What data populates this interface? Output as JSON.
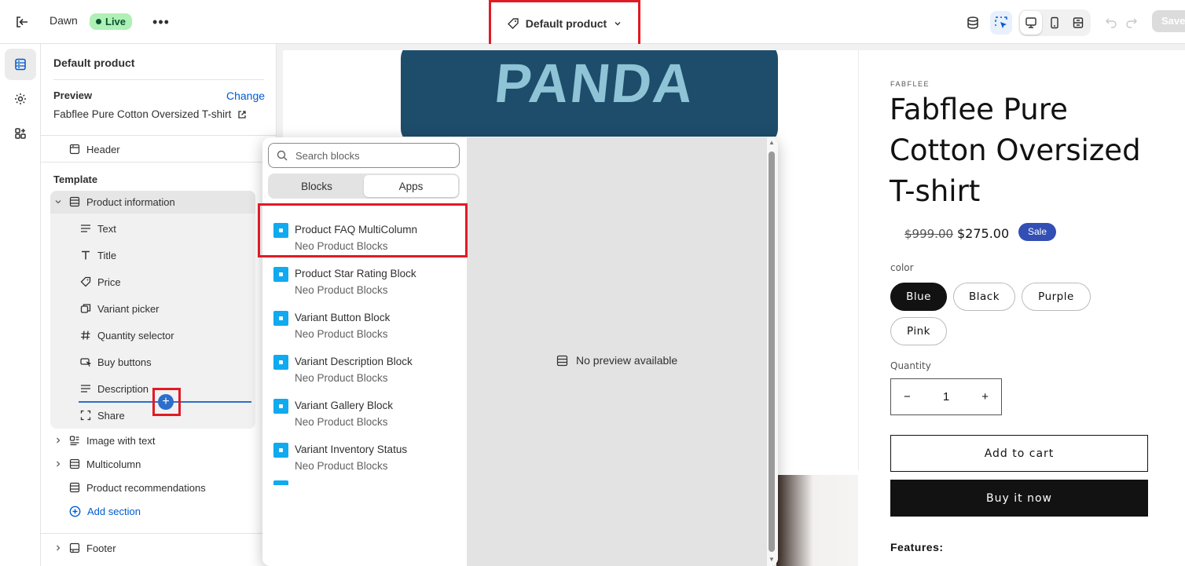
{
  "topbar": {
    "theme_name": "Dawn",
    "live_label": "Live",
    "template_label": "Default product",
    "save_label": "Save"
  },
  "sidebar": {
    "title": "Default product",
    "preview_label": "Preview",
    "change_label": "Change",
    "preview_product": "Fabflee Pure Cotton Oversized T-shirt",
    "header_label": "Header",
    "template_label": "Template",
    "product_information": "Product information",
    "blocks": [
      "Text",
      "Title",
      "Price",
      "Variant picker",
      "Quantity selector",
      "Buy buttons",
      "Description",
      "Share"
    ],
    "sections": [
      "Image with text",
      "Multicolumn",
      "Product recommendations"
    ],
    "add_section": "Add section",
    "footer_label": "Footer"
  },
  "popover": {
    "search_placeholder": "Search blocks",
    "tabs": [
      "Blocks",
      "Apps"
    ],
    "active_tab": "Apps",
    "items": [
      {
        "title": "Product FAQ MultiColumn",
        "subtitle": "Neo Product Blocks"
      },
      {
        "title": "Product Star Rating Block",
        "subtitle": "Neo Product Blocks"
      },
      {
        "title": "Variant Button Block",
        "subtitle": "Neo Product Blocks"
      },
      {
        "title": "Variant Description Block",
        "subtitle": "Neo Product Blocks"
      },
      {
        "title": "Variant Gallery Block",
        "subtitle": "Neo Product Blocks"
      },
      {
        "title": "Variant Inventory Status",
        "subtitle": "Neo Product Blocks"
      }
    ],
    "no_preview": "No preview available",
    "app_icon_color": "#10aaf0"
  },
  "product": {
    "vendor": "FABFLEE",
    "title": "Fabflee Pure Cotton Oversized T-shirt",
    "price_old": "$999.00",
    "price_new": "$275.00",
    "sale_badge": "Sale",
    "option_label": "color",
    "colors": [
      "Blue",
      "Black",
      "Purple",
      "Pink"
    ],
    "selected_color": "Blue",
    "quantity_label": "Quantity",
    "quantity_value": "1",
    "add_to_cart": "Add to cart",
    "buy_now": "Buy it now",
    "features_label": "Features:",
    "shirt_print": "PANDA",
    "sale_color": "#334fb4"
  }
}
